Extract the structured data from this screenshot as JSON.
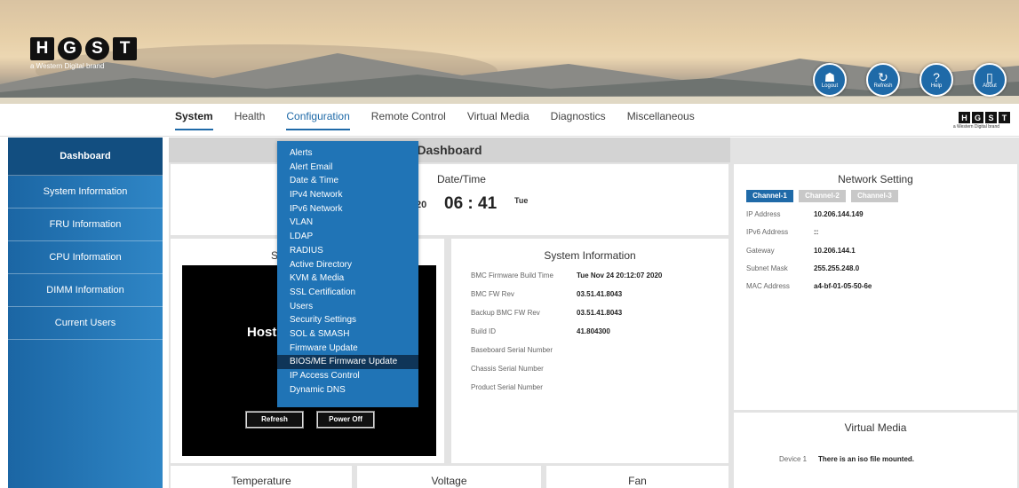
{
  "header": {
    "logo_letters": [
      "H",
      "G",
      "S",
      "T"
    ],
    "brand_sub": "a Western Digital brand",
    "icons": [
      {
        "name": "logout",
        "label": "Logout",
        "glyph": "☗"
      },
      {
        "name": "refresh",
        "label": "Refresh",
        "glyph": "↻"
      },
      {
        "name": "help",
        "label": "Help",
        "glyph": "?"
      },
      {
        "name": "about",
        "label": "About",
        "glyph": "▯"
      }
    ]
  },
  "nav": {
    "tabs": [
      "System",
      "Health",
      "Configuration",
      "Remote Control",
      "Virtual Media",
      "Diagnostics",
      "Miscellaneous"
    ],
    "small_logo_sub": "a Western Digital brand"
  },
  "sidebar": {
    "items": [
      "Dashboard",
      "System Information",
      "FRU Information",
      "CPU Information",
      "DIMM Information",
      "Current Users"
    ]
  },
  "dashboard": {
    "title": "Dashboard",
    "datetime": {
      "title": "Date/Time",
      "date_frag": "20",
      "time": "06 : 41",
      "day": "Tue"
    },
    "server": {
      "title_frag": "S",
      "host_frag": "Host",
      "refresh": "Refresh",
      "power_off": "Power Off"
    },
    "sysinfo": {
      "title": "System Information",
      "rows": [
        {
          "k": "BMC Firmware Build Time",
          "v": "Tue Nov 24 20:12:07 2020"
        },
        {
          "k": "BMC FW Rev",
          "v": "03.51.41.8043"
        },
        {
          "k": "Backup BMC FW Rev",
          "v": "03.51.41.8043"
        },
        {
          "k": "Build ID",
          "v": "41.804300"
        },
        {
          "k": "Baseboard Serial Number",
          "v": ""
        },
        {
          "k": "Chassis Serial Number",
          "v": ""
        },
        {
          "k": "Product Serial Number",
          "v": ""
        }
      ]
    },
    "network": {
      "title": "Network Setting",
      "channels": [
        "Channel-1",
        "Channel-2",
        "Channel-3"
      ],
      "rows": [
        {
          "k": "IP Address",
          "v": "10.206.144.149"
        },
        {
          "k": "IPv6 Address",
          "v": "::"
        },
        {
          "k": "Gateway",
          "v": "10.206.144.1"
        },
        {
          "k": "Subnet Mask",
          "v": "255.255.248.0"
        },
        {
          "k": "MAC Address",
          "v": "a4-bf-01-05-50-6e"
        }
      ]
    },
    "virtual_media": {
      "title": "Virtual Media",
      "device_label": "Device 1",
      "device_value": "There is an iso file mounted."
    },
    "bottom": {
      "temperature": "Temperature",
      "voltage": "Voltage",
      "fan": "Fan"
    }
  },
  "config_menu": {
    "items": [
      "Alerts",
      "Alert Email",
      "Date & Time",
      "IPv4 Network",
      "IPv6 Network",
      "VLAN",
      "LDAP",
      "RADIUS",
      "Active Directory",
      "KVM & Media",
      "SSL Certification",
      "Users",
      "Security Settings",
      "SOL & SMASH",
      "Firmware Update",
      "BIOS/ME Firmware Update",
      "IP Access Control",
      "Dynamic DNS"
    ],
    "highlighted": "BIOS/ME Firmware Update"
  },
  "colors": {
    "accent": "#1f6aa8",
    "sidebar": "#2074b6",
    "highlight": "#0f3558"
  }
}
